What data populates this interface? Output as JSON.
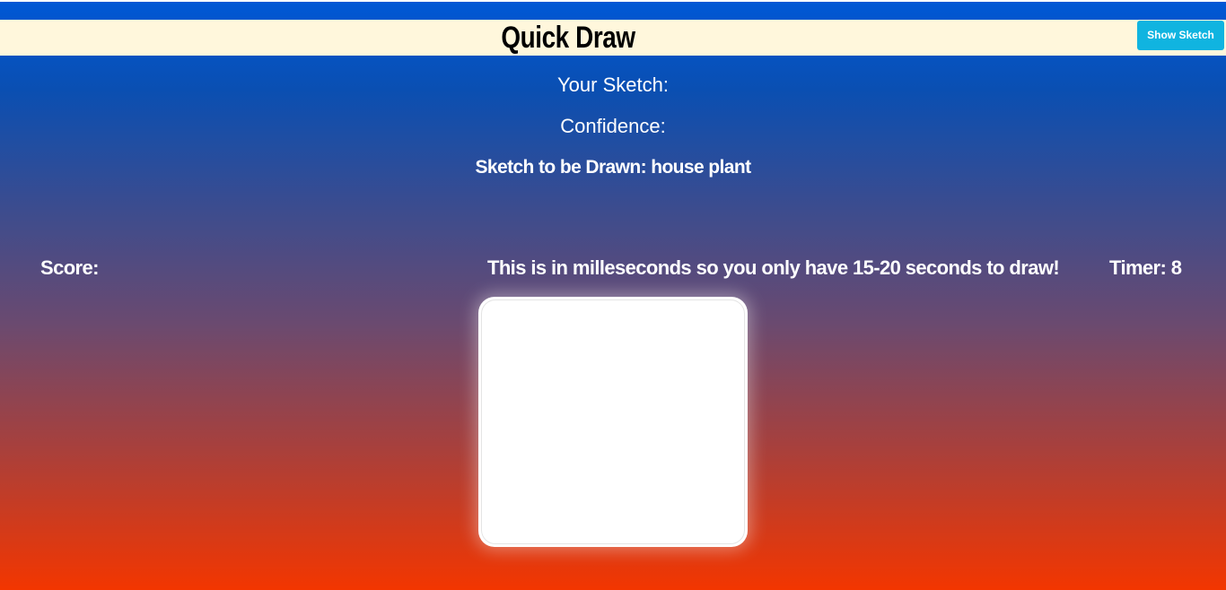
{
  "header": {
    "title": "Quick Draw",
    "show_sketch_label": "Show Sketch"
  },
  "info": {
    "your_sketch_label": "Your Sketch:",
    "confidence_label": "Confidence:",
    "sketch_to_draw": "Sketch to be Drawn: house plant"
  },
  "status": {
    "score_label": "Score:",
    "note": "This is in milleseconds so you only have 15-20 seconds to draw!",
    "timer": "Timer: 8"
  },
  "colors": {
    "header_background": "#fff7dc",
    "button_background": "#10b4e0",
    "gradient_top": "#0058d6",
    "gradient_bottom": "#f33600"
  }
}
